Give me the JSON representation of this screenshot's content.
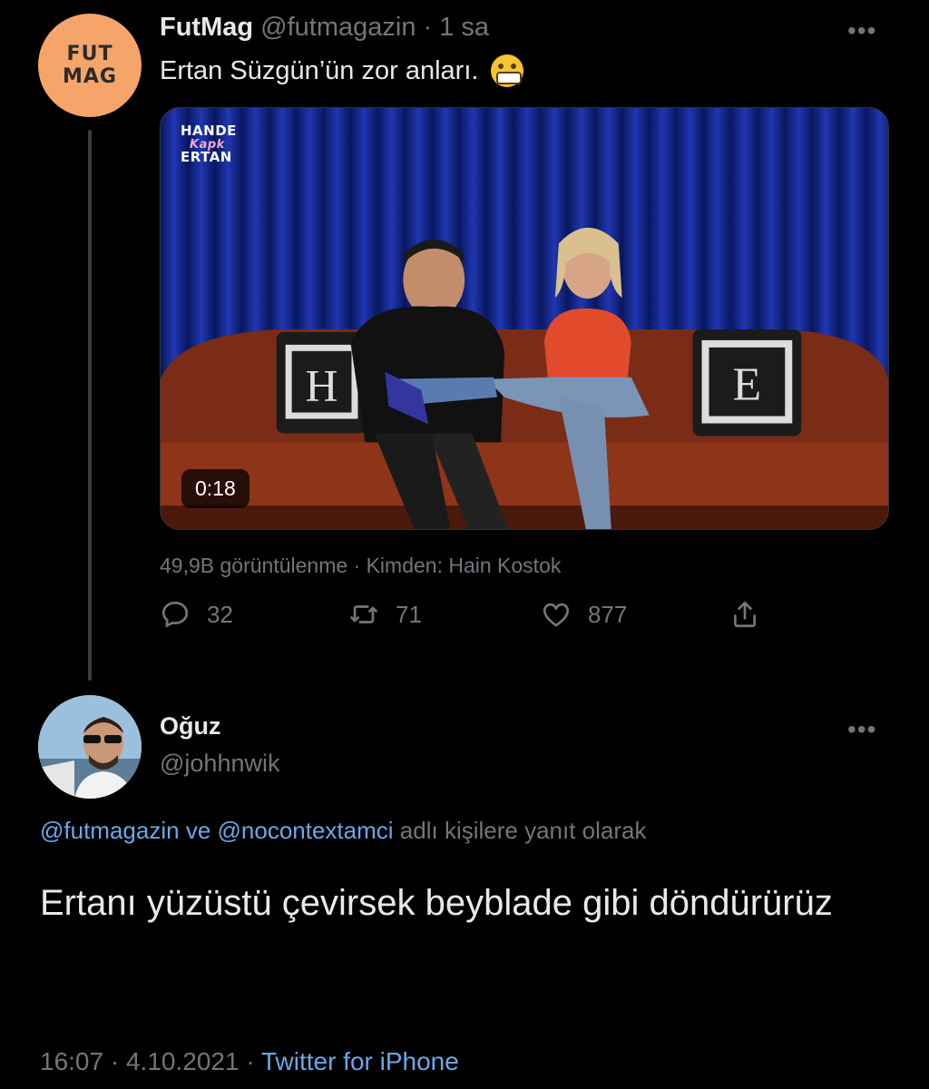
{
  "tweet": {
    "avatar_text": [
      "FUT",
      "MAG"
    ],
    "name": "FutMag",
    "handle": "@futmagazin",
    "separator": "·",
    "age": "1 sa",
    "text": "Ertan Süzgün’ün zor anları.",
    "emoji": "grimacing-face",
    "more": "•••",
    "media": {
      "logo_top": "HANDE",
      "logo_mid": "Kapk",
      "logo_bottom": "ERTAN",
      "duration": "0:18",
      "pillow_left": "H",
      "pillow_right": "E"
    },
    "views": "49,9B görüntülenme · Kimden: Hain Kostok",
    "replies": "32",
    "retweets": "71",
    "likes": "877"
  },
  "reply": {
    "name": "Oğuz",
    "handle": "@johhnwik",
    "more": "•••",
    "mention1": "@futmagazin",
    "and_word": "ve",
    "mention2": "@nocontextamci",
    "context_suffix": "adlı kişilere yanıt olarak",
    "text": "Ertanı yüzüstü çevirsek beyblade gibi döndürürüz",
    "time": "16:07",
    "date": "4.10.2021",
    "separator": "·",
    "source": "Twitter for iPhone"
  },
  "colors": {
    "background": "#000000",
    "text": "#e7e9ea",
    "muted": "#71767b",
    "link": "#6aa8e8",
    "futmag_avatar": "#f5a46a"
  }
}
